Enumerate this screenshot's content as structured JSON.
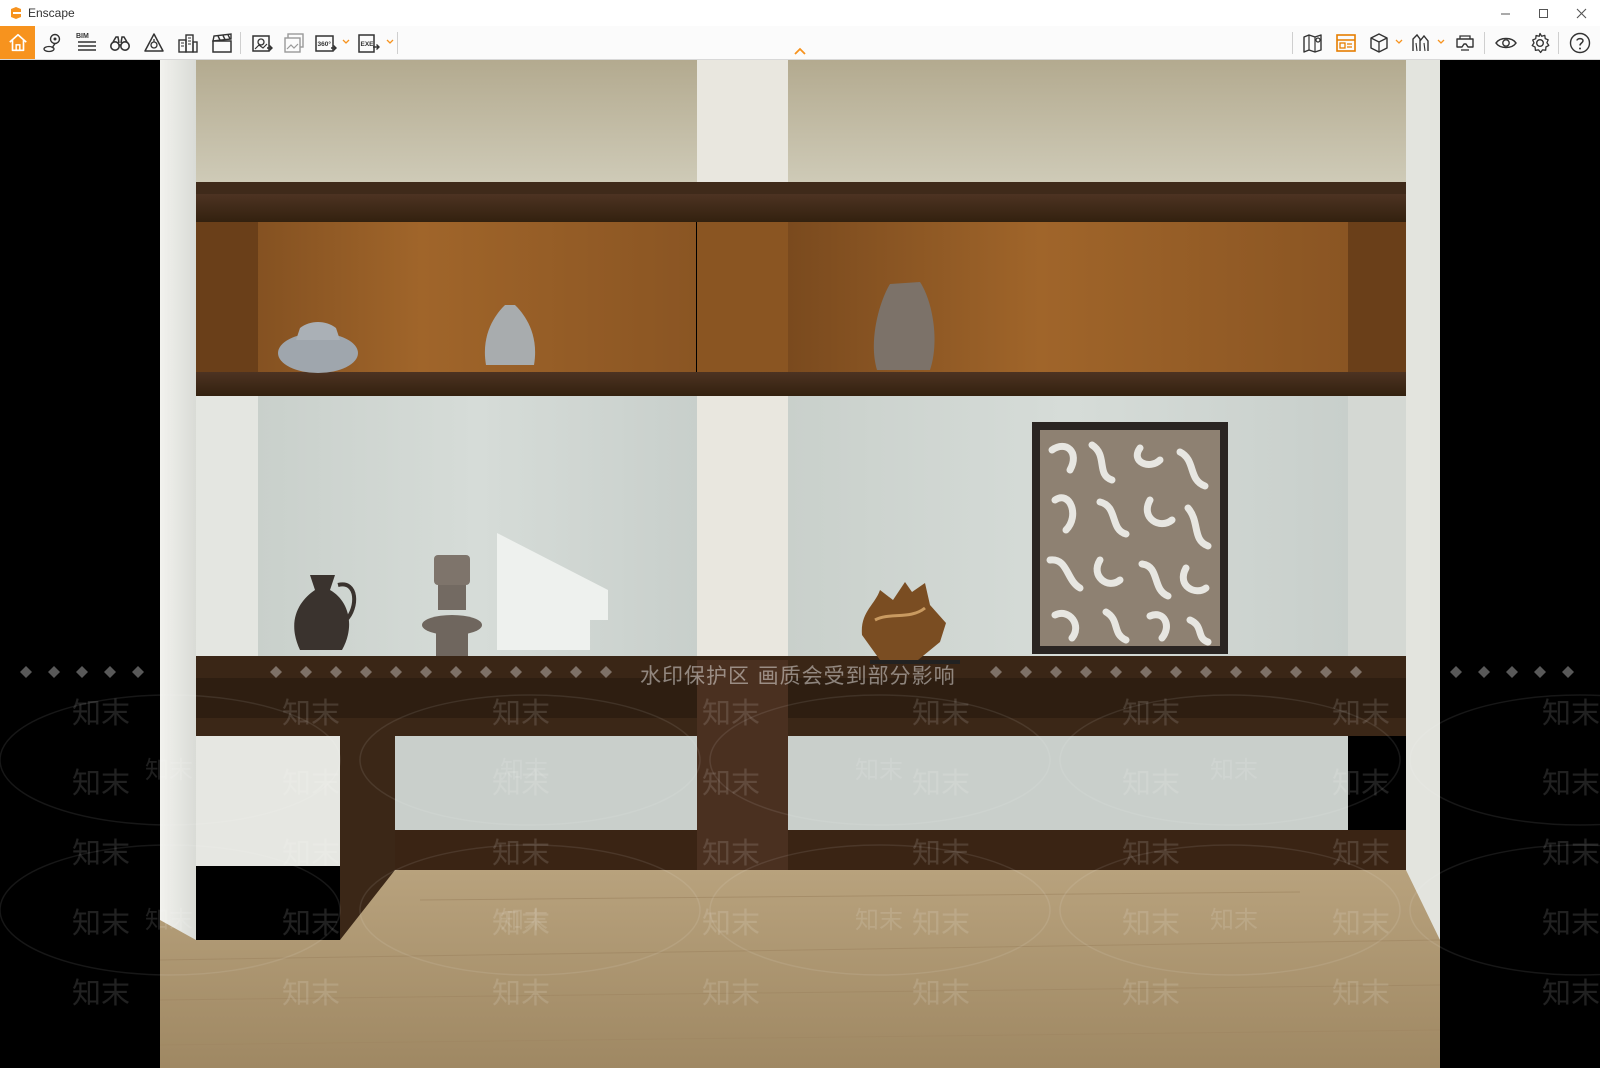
{
  "app": {
    "title": "Enscape",
    "brand_color": "#f7931e"
  },
  "window_controls": {
    "minimize": "minimize-icon",
    "maximize": "maximize-icon",
    "close": "close-icon"
  },
  "toolbar": {
    "left": [
      "home-icon",
      "map-pin-icon",
      "bim-icon",
      "binoculars-icon",
      "warning-cone-icon",
      "buildings-icon",
      "clapperboard-icon",
      "screenshot-icon",
      "batch-render-icon",
      "panorama-360-icon",
      "export-exe-icon"
    ],
    "right": [
      "map-icon",
      "asset-library-icon",
      "cube-icon",
      "material-icon",
      "vr-headset-icon",
      "eye-icon",
      "gear-icon",
      "help-icon"
    ],
    "bim_label": "BIM",
    "pano_label": "360°",
    "exe_label": "EXE"
  },
  "watermark": {
    "notice": "水印保护区   画质会受到部分影响",
    "brand": "知末"
  }
}
